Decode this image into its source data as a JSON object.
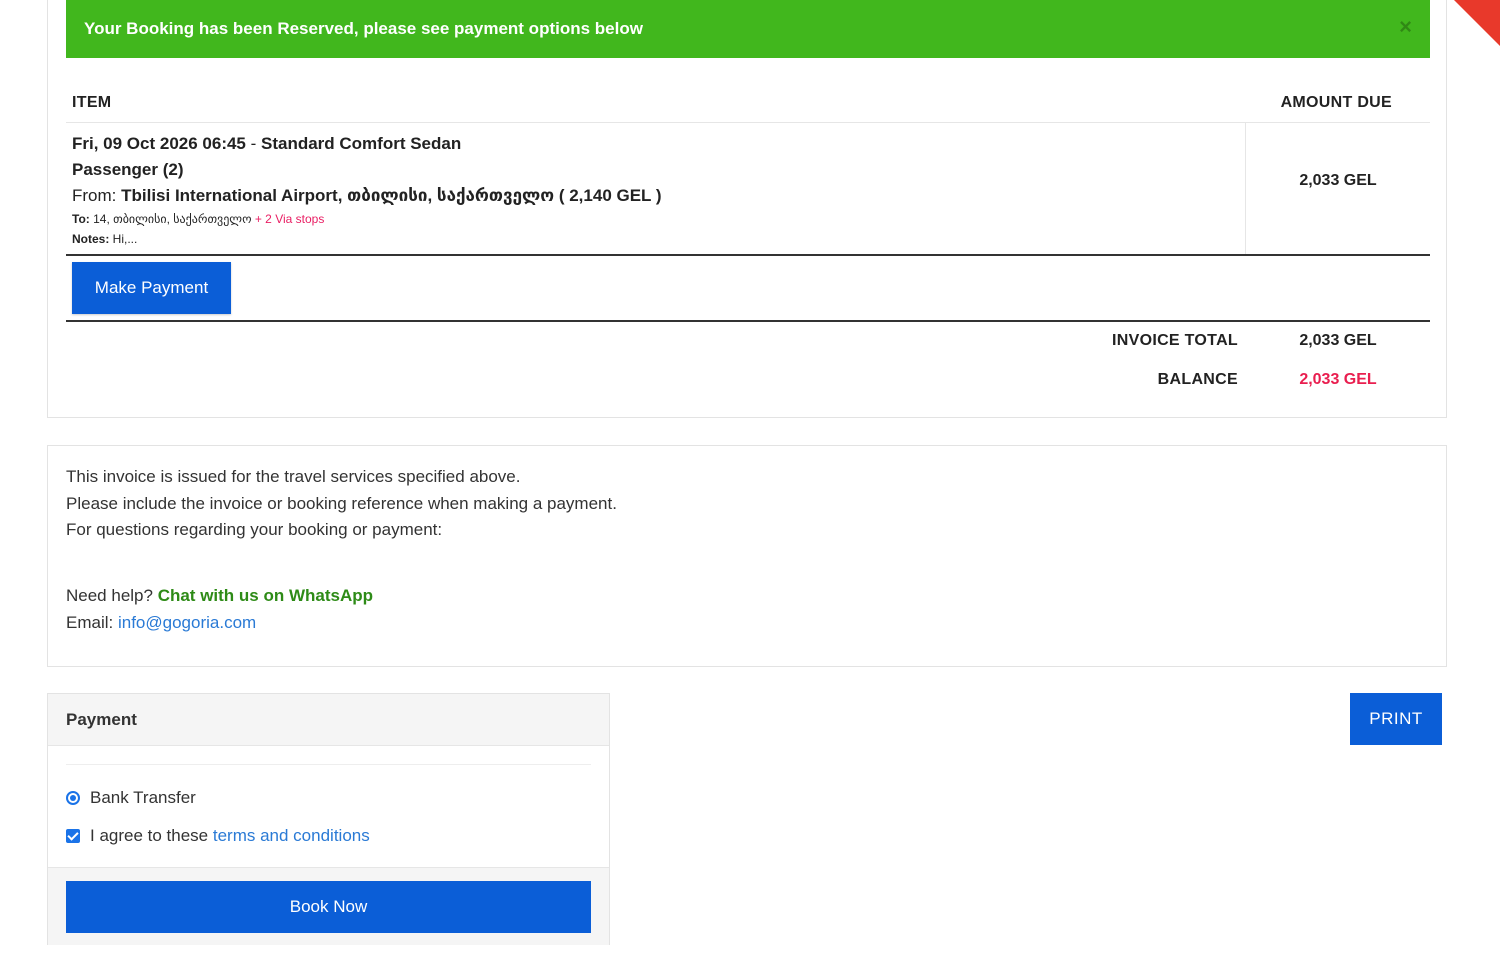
{
  "alert": {
    "message": "Your Booking has been Reserved, please see payment options below",
    "close_glyph": "×"
  },
  "invoice": {
    "headers": {
      "item": "ITEM",
      "amount_due": "AMOUNT DUE"
    },
    "item": {
      "datetime": "Fri, 09 Oct 2026 06:45",
      "separator": " - ",
      "vehicle": "Standard Comfort Sedan",
      "passengers": "Passenger (2)",
      "from_label": "From: ",
      "from_place": "Tbilisi International Airport, თბილისი, საქართველო",
      "from_price": " ( 2,140 GEL )",
      "to_label": "To:",
      "to_place": " 14, თბილისი, საქართველო ",
      "via_stops": "+ 2 Via stops",
      "notes_label": "Notes:",
      "notes_text": " Hi,..."
    },
    "item_amount": "2,033 GEL",
    "make_payment_label": "Make Payment",
    "totals": {
      "invoice_total_label": "INVOICE TOTAL",
      "invoice_total_value": "2,033 GEL",
      "balance_label": "BALANCE",
      "balance_value": "2,033 GEL"
    }
  },
  "info": {
    "lines": [
      "This invoice is issued for the travel services specified above.",
      "Please include the invoice or booking reference when making a payment.",
      "For questions regarding your booking or payment:"
    ],
    "help_label": "Need help? ",
    "whatsapp_link": "Chat with us on WhatsApp",
    "email_label": "Email: ",
    "email": "info@gogoria.com"
  },
  "payment": {
    "title": "Payment",
    "method_label": "Bank Transfer",
    "agree_label": "I agree to these ",
    "terms_link": "terms and conditions",
    "book_now_label": "Book Now"
  },
  "print_label": "PRINT",
  "colors": {
    "alert_green": "#41b71d",
    "primary_blue": "#0b5ed7",
    "balance_red": "#e91e4f",
    "whatsapp_green": "#2e8b17",
    "link_blue": "#2a7ad5",
    "ribbon_red": "#e8392b"
  }
}
